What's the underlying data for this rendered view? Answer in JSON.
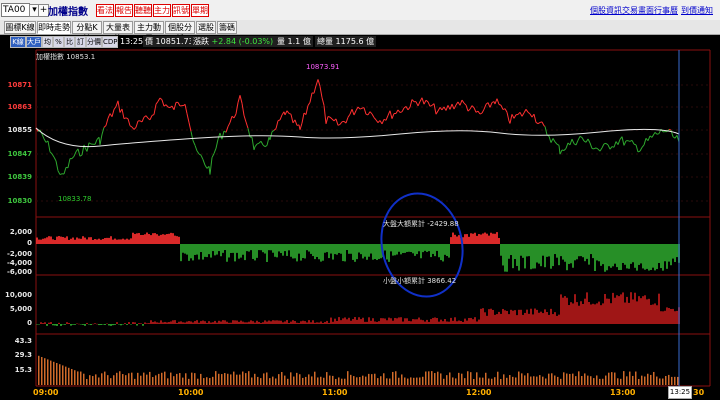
{
  "toolbar": {
    "symbol_value": "TA00",
    "add_button": "+",
    "brand": "加權指數",
    "buttons": [
      "看法",
      "報告",
      "聽聽",
      "主力",
      "訊號",
      "單期"
    ],
    "links": [
      "個股資訊",
      "交易畫面",
      "行事曆",
      "到價通知"
    ]
  },
  "tabs": [
    "圖標K線",
    "即時走勢",
    "分點K線",
    "大量表格",
    "主力動量",
    "個股分析",
    "選股",
    "籌碼"
  ],
  "chart_toolbar": {
    "buttons": [
      "K線",
      "大戶",
      "均",
      "%",
      "比",
      "訂",
      "分價",
      "CDP"
    ],
    "time": "13:25",
    "price_label": "價",
    "price": "10851.73",
    "change_label": "漲跌",
    "change": "+2.84 (-0.03%)",
    "volume_label": "量",
    "volume": "1.1 億",
    "total_label": "總量",
    "total": "1175.6 億"
  },
  "main_chart": {
    "title": "加權指數 10853.1",
    "y_ticks": [
      "10871",
      "10863",
      "10855",
      "10847",
      "10839",
      "10830"
    ],
    "high_label": "10873.91",
    "low_label": "10833.78"
  },
  "panel_big": {
    "label": "大盤大額累計 -2429.88",
    "y_ticks": [
      "2,000",
      "0",
      "-2,000",
      "-4,000",
      "-6,000"
    ]
  },
  "panel_small": {
    "label": "小盤小額累計 3866.42",
    "y_ticks": [
      "10,000",
      "5,000",
      "0"
    ]
  },
  "panel_volume": {
    "y_ticks": [
      "43.3",
      "29.3",
      "15.3"
    ]
  },
  "x_axis": {
    "ticks": [
      "09:00",
      "10:00",
      "11:00",
      "12:00",
      "13:00"
    ],
    "current_time": "13:25",
    "end_label": "30"
  },
  "colors": {
    "up": "#ff3030",
    "down": "#2ea82e",
    "average": "#e8e8e8",
    "annotation": "#1030c8",
    "volume": "#d06a2a"
  }
}
